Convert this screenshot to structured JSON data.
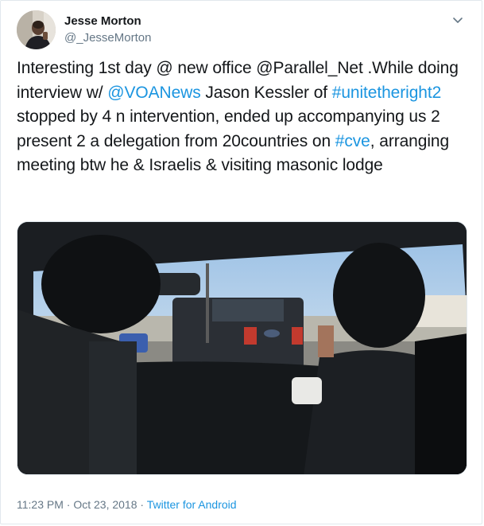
{
  "author": {
    "display_name": "Jesse Morton",
    "handle": "@_JesseMorton"
  },
  "tweet": {
    "segments": [
      {
        "text": "Interesting 1st day @ new office @Parallel_Net .While doing interview w/ ",
        "link": false
      },
      {
        "text": "@VOANews",
        "link": true
      },
      {
        "text": " Jason Kessler of ",
        "link": false
      },
      {
        "text": "#unitetheright2",
        "link": true
      },
      {
        "text": " stopped by 4 n intervention, ended up accompanying us 2 present 2 a delegation from 20countries on ",
        "link": false
      },
      {
        "text": "#cve",
        "link": true
      },
      {
        "text": ", arranging meeting btw he & Israelis & visiting masonic lodge",
        "link": false
      }
    ]
  },
  "footer": {
    "time": "11:23 PM",
    "separator1": " · ",
    "date": "Oct 23, 2018",
    "separator2": " · ",
    "source": "Twitter for Android"
  },
  "icons": {
    "menu": "chevron-down-icon"
  },
  "colors": {
    "link": "#1b95e0",
    "secondary_text": "#657786",
    "border": "#e1e8ed"
  }
}
